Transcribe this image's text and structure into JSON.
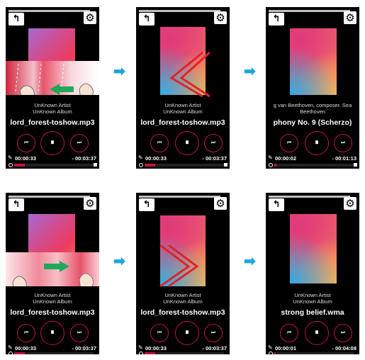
{
  "icons": {
    "back": "back-arrow-icon",
    "settings": "gear-icon",
    "prev": "previous-track-icon",
    "pause": "pause-icon",
    "next": "next-track-icon"
  },
  "colors": {
    "accent": "#c0163a",
    "step_arrow": "#19a7e0",
    "swipe_arrow": "#1fa85a",
    "chevrons": "#e0232b"
  },
  "glyphs": {
    "back": "↰",
    "gear": "⚙",
    "prev": "⏮",
    "pause": "⏸",
    "next": "⏭",
    "arrow": "➡",
    "pin": "✎"
  },
  "panels": [
    {
      "artist": "UnKnown Artist",
      "album": "UnKnown Album",
      "title": "lord_forest-toshow.mp3",
      "elapsed": "00:00:33",
      "remaining": "- 00:03:37",
      "progress": 0.13
    },
    {
      "artist": "UnKnown Artist",
      "album": "UnKnown Album",
      "title": "lord_forest-toshow.mp3",
      "elapsed": "00:00:33",
      "remaining": "- 00:03:37",
      "progress": 0.13
    },
    {
      "artist": "g van Beethoven, composer. Sea",
      "album": "Beethoven",
      "title": "phony No. 9 (Scherzo)",
      "elapsed": "00:00:02",
      "remaining": "- 00:01:13",
      "progress": 0.03
    },
    {
      "artist": "UnKnown Artist",
      "album": "UnKnown Album",
      "title": "lord_forest-toshow.mp3",
      "elapsed": "00:00:33",
      "remaining": "- 00:03:37",
      "progress": 0.13
    },
    {
      "artist": "UnKnown Artist",
      "album": "UnKnown Album",
      "title": "lord_forest-toshow.mp3",
      "elapsed": "00:00:33",
      "remaining": "- 00:03:37",
      "progress": 0.13
    },
    {
      "artist": "UnKnown Artist",
      "album": "UnKnown Album",
      "title": "strong belief.wma",
      "elapsed": "00:00:01",
      "remaining": "- 00:04:08",
      "progress": 0.02
    }
  ]
}
